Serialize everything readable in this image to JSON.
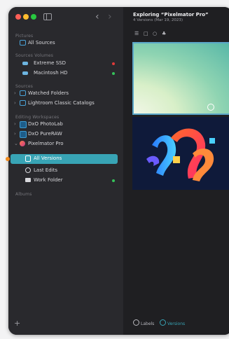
{
  "content": {
    "title": "Exploring “Pixelmator Pro”",
    "subtitle": "4 Versions (Mar 19, 2023)"
  },
  "sidebar": {
    "sections": {
      "pictures": "Pictures",
      "volumes": "Sources Volumes",
      "sources": "Sources",
      "editing": "Editing Workspaces",
      "albums": "Albums"
    },
    "all_sources": "All Sources",
    "volumes": [
      {
        "label": "Extreme SSD",
        "status_color": "#e03a3a"
      },
      {
        "label": "Macintosh HD",
        "status_color": "#35c25a"
      }
    ],
    "watched_folders": "Watched Folders",
    "lightroom": "Lightroom Classic Catalogs",
    "dxo_photolab": "DxO PhotoLab",
    "dxo_pureraw": "DxO PureRAW",
    "pixelmator": "Pixelmator Pro",
    "pixelmator_children": [
      {
        "label": "All Versions"
      },
      {
        "label": "Last Edits"
      },
      {
        "label": "Work Folder",
        "status_color": "#35c25a"
      }
    ]
  },
  "bottombar": {
    "labels": "Labels",
    "versions": "Versions"
  },
  "colors": {
    "accent": "#38a4b5",
    "sidebar": "#29292d",
    "window": "#1f1f22"
  },
  "icons": {
    "back": "‹",
    "forward": "›",
    "add": "+",
    "chevron_right": "›",
    "chevron_down": "⌄",
    "toolbar": [
      "☰",
      "□",
      "○",
      "♣"
    ]
  }
}
